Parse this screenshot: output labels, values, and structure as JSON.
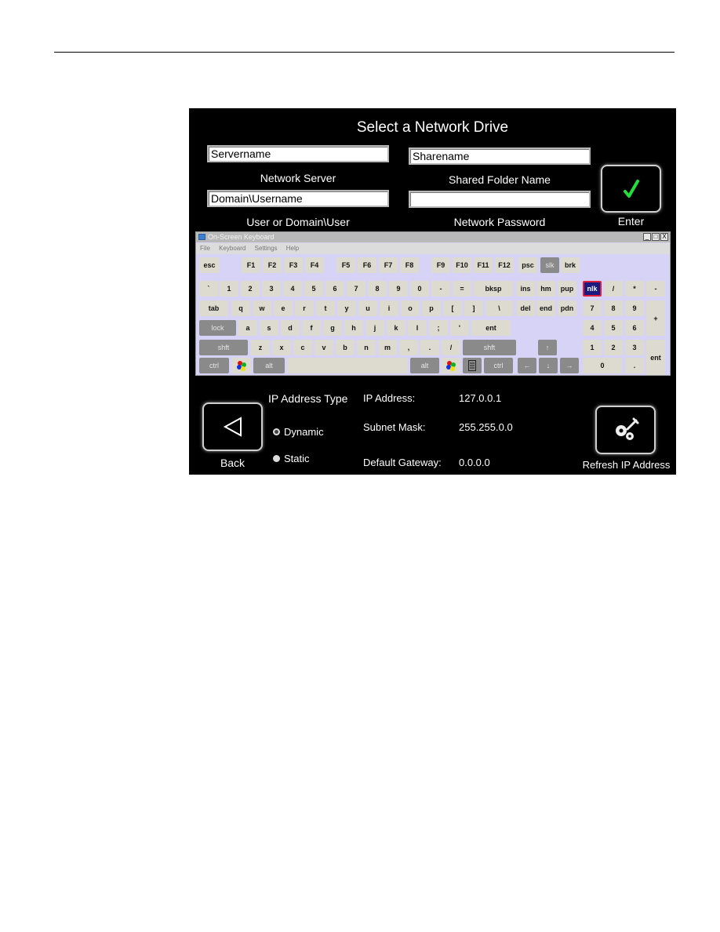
{
  "dialog": {
    "title": "Select a Network Drive",
    "fields": {
      "server": {
        "value": "Servername",
        "label": "Network Server"
      },
      "share": {
        "value": "Sharename",
        "label": "Shared Folder Name"
      },
      "user": {
        "value": "Domain\\Username",
        "label": "User or Domain\\User"
      },
      "password": {
        "value": "",
        "label": "Network Password"
      }
    },
    "enter_label": "Enter",
    "back_label": "Back",
    "refresh_label": "Refresh IP Address",
    "accent_check_color": "#22e03a"
  },
  "osk": {
    "title": "On-Screen Keyboard",
    "menu": [
      "File",
      "Keyboard",
      "Settings",
      "Help"
    ],
    "window_buttons": [
      "_",
      "□",
      "X"
    ],
    "rows": {
      "fn": [
        "esc",
        "F1",
        "F2",
        "F3",
        "F4",
        "F5",
        "F6",
        "F7",
        "F8",
        "F9",
        "F10",
        "F11",
        "F12",
        "psc",
        "slk",
        "brk"
      ],
      "num": [
        "`",
        "1",
        "2",
        "3",
        "4",
        "5",
        "6",
        "7",
        "8",
        "9",
        "0",
        "-",
        "=",
        "bksp",
        "ins",
        "hm",
        "pup",
        "nlk",
        "/",
        "*",
        "-"
      ],
      "top": [
        "tab",
        "q",
        "w",
        "e",
        "r",
        "t",
        "y",
        "u",
        "i",
        "o",
        "p",
        "[",
        "]",
        "\\",
        "del",
        "end",
        "pdn",
        "7",
        "8",
        "9",
        "+"
      ],
      "home": [
        "lock",
        "a",
        "s",
        "d",
        "f",
        "g",
        "h",
        "j",
        "k",
        "l",
        ";",
        "'",
        "ent",
        "4",
        "5",
        "6"
      ],
      "bottom": [
        "shft",
        "z",
        "x",
        "c",
        "v",
        "b",
        "n",
        "m",
        ",",
        ".",
        "/",
        "shft",
        "↑",
        "1",
        "2",
        "3",
        "ent"
      ],
      "space": [
        "ctrl",
        "win",
        "alt",
        "",
        "alt",
        "win",
        "menu",
        "ctrl",
        "←",
        "↓",
        "→",
        "0",
        "."
      ]
    }
  },
  "network": {
    "type_heading": "IP Address Type",
    "options": [
      {
        "label": "Dynamic",
        "selected": true
      },
      {
        "label": "Static",
        "selected": false
      }
    ],
    "ip_label": "IP Address:",
    "ip_value": "127.0.0.1",
    "mask_label": "Subnet Mask:",
    "mask_value": "255.255.0.0",
    "gateway_label": "Default Gateway:",
    "gateway_value": "0.0.0.0"
  }
}
